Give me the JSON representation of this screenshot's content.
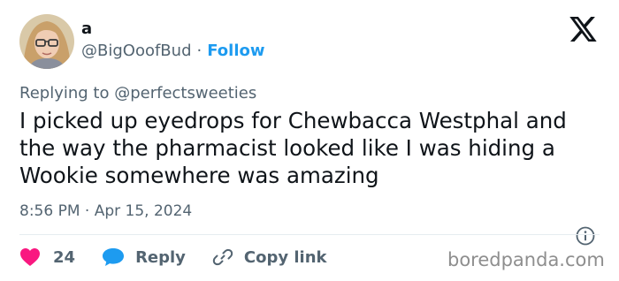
{
  "author": {
    "display_name": "a",
    "handle": "@BigOoofBud",
    "separator": "·",
    "follow_label": "Follow"
  },
  "reply_context": {
    "prefix": "Replying to",
    "mention": "@perfectsweeties"
  },
  "tweet": {
    "text": "I picked up eyedrops for Chewbacca Westphal and the way the pharmacist looked like I was hiding a Wookie somewhere was amazing",
    "time": "8:56 PM",
    "separator": "·",
    "date": "Apr 15, 2024"
  },
  "actions": {
    "like_count": "24",
    "reply_label": "Reply",
    "copy_label": "Copy link"
  },
  "watermark": "boredpanda.com",
  "icons": {
    "logo": "x-logo-icon",
    "info": "info-icon",
    "like": "heart-icon",
    "reply": "speech-bubble-icon",
    "copy": "link-icon"
  },
  "colors": {
    "like": "#f91880",
    "reply": "#1d9bf0",
    "follow": "#1d9bf0",
    "secondary_text": "#536471",
    "primary_text": "#0f1419"
  }
}
